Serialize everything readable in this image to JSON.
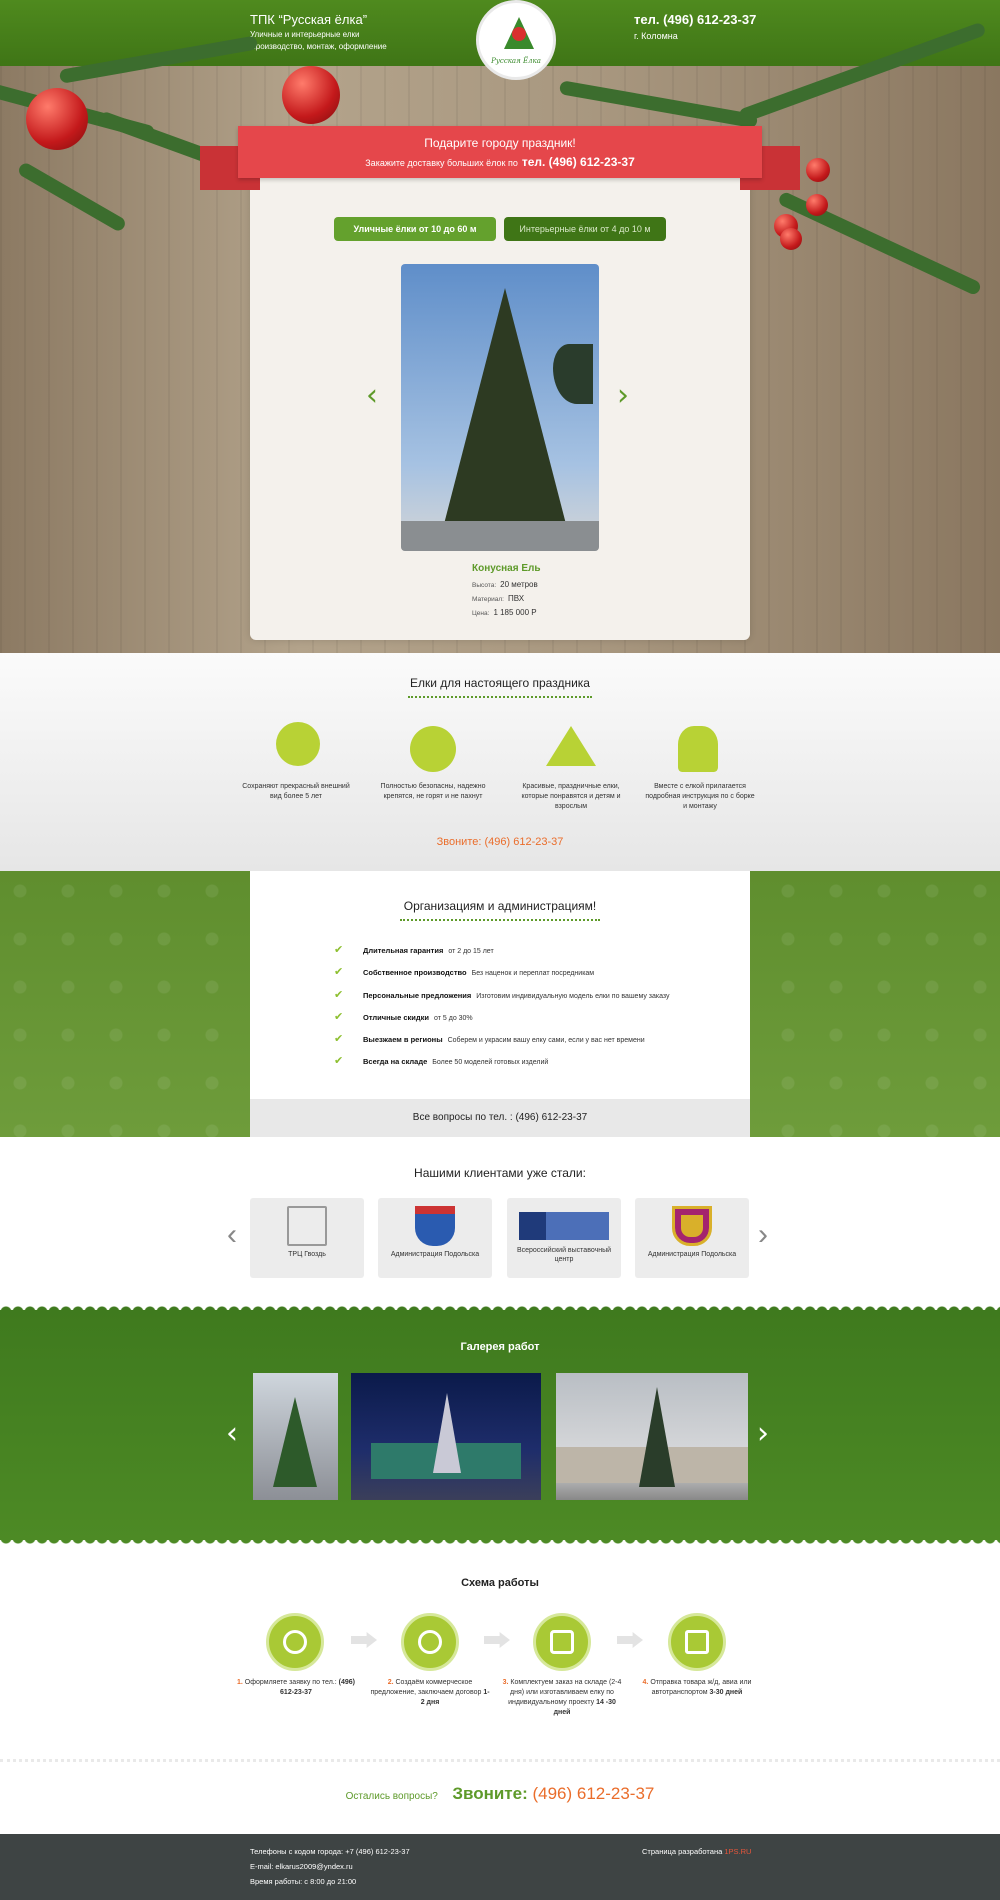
{
  "header": {
    "company": "ТПК “Русская ёлка”",
    "tagline1": "Уличные и интерьерные елки",
    "tagline2": "Производство, монтаж, оформление",
    "phone": "тел. (496) 612-23-37",
    "city": "г. Коломна",
    "logo_caption": "Русская Ёлка"
  },
  "hero": {
    "ribbon_title": "Подарите городу праздник!",
    "ribbon_text": "Закажите доставку больших  ёлок  по",
    "ribbon_phone": "тел. (496) 612-23-37",
    "tab_street": "Уличные ёлки от 10 до 60 м",
    "tab_interior": "Интерьерные ёлки от 4 до 10 м",
    "prev_glyph": "‹",
    "next_glyph": "›",
    "product": {
      "name": "Конусная Ель",
      "height_label": "Высота:",
      "height_value": "20 метров",
      "material_label": "Материал:",
      "material_value": "ПВХ",
      "price_label": "Цена:",
      "price_value": "1 185 000 Р"
    }
  },
  "features": {
    "title": "Елки для настоящего праздника",
    "items": [
      {
        "icon": "thumbs-up-clock-icon",
        "text": "Сохраняют прекрасный внешний вид более 5 лет"
      },
      {
        "icon": "medal-tree-icon",
        "text": "Полностью безопасны, надежно крепятся, не горят и  не пахнут"
      },
      {
        "icon": "family-trees-icon",
        "text": "Красивые, праздничные елки, которые понравятся и детям и взрослым"
      },
      {
        "icon": "worker-icon",
        "text": "Вместе с елкой прилагается подробная инструкция по с борке и монтажу"
      }
    ],
    "call": "Звоните: ",
    "call_phone": "(496) 612-23-37"
  },
  "orgs": {
    "title": "Организациям и администрациям!",
    "items": [
      {
        "bold": "Длительная гарантия",
        "text": "от 2 до 15 лет"
      },
      {
        "bold": "Собственное производство",
        "text": "Без наценок и переплат посредникам"
      },
      {
        "bold": "Персональные предложения",
        "text": "Изготовим индивидуальную модель елки по вашему заказу"
      },
      {
        "bold": "Отличные скидки",
        "text": "от 5 до 30%"
      },
      {
        "bold": "Выезжаем в  регионы",
        "text": "Соберем и украсим вашу елку сами, если у вас нет времени"
      },
      {
        "bold": "Всегда на складе",
        "text": "Более 50 моделей готовых изделий"
      }
    ],
    "check_glyph": "✔",
    "footer": "Все вопросы по тел. : (496) 612-23-37"
  },
  "clients": {
    "title": "Нашими клиентами уже стали:",
    "prev_glyph": "‹",
    "next_glyph": "›",
    "items": [
      {
        "name": "ТРЦ Гвоздь",
        "icon": "gvozd-logo-icon"
      },
      {
        "name": "Администрация Подольска",
        "icon": "podolsk-crest-icon"
      },
      {
        "name": "Всероссийский выставочный центр",
        "icon": "vvc-logo-icon"
      },
      {
        "name": "Администрация Подольска",
        "icon": "crest-bird-icon"
      }
    ]
  },
  "gallery": {
    "title": "Галерея работ",
    "prev_glyph": "‹",
    "next_glyph": "›"
  },
  "scheme": {
    "title": "Схема работы",
    "steps": [
      {
        "n": "1.",
        "text": "Оформляете заявку по тел.:",
        "bold": "(496) 612-23-37",
        "icon": "phone-icon"
      },
      {
        "n": "2.",
        "text": "Создаём коммерческое предложение, заключаем договор",
        "bold": "1-2 дня",
        "icon": "handshake-icon"
      },
      {
        "n": "3.",
        "text": "Комплектуем заказ на складе (2-4 дня) или изготавливаем елку по индивидуальному проекту",
        "bold": "14 -30 дней",
        "icon": "box-icon"
      },
      {
        "n": "4.",
        "text": "Отправка товара ж/д, авиа или автотранспортом",
        "bold": "3-30 дней",
        "icon": "truck-icon"
      }
    ]
  },
  "question": {
    "text": "Остались вопросы?",
    "call": "Звоните: ",
    "phone": "(496) 612-23-37"
  },
  "footer": {
    "phones": "Телефоны с кодом города: +7 (496) 612-23-37",
    "email": "E-mail: elkarus2009@yndex.ru",
    "hours": "Время работы: с 8:00 до 21:00",
    "dev_text": "Страница разработана",
    "dev_link": "1PS.RU"
  },
  "colors": {
    "green": "#4f8a1e",
    "lightgreen": "#a9c935",
    "red": "#e5474b",
    "orange": "#ea6d2b",
    "footer": "#3e4444"
  }
}
